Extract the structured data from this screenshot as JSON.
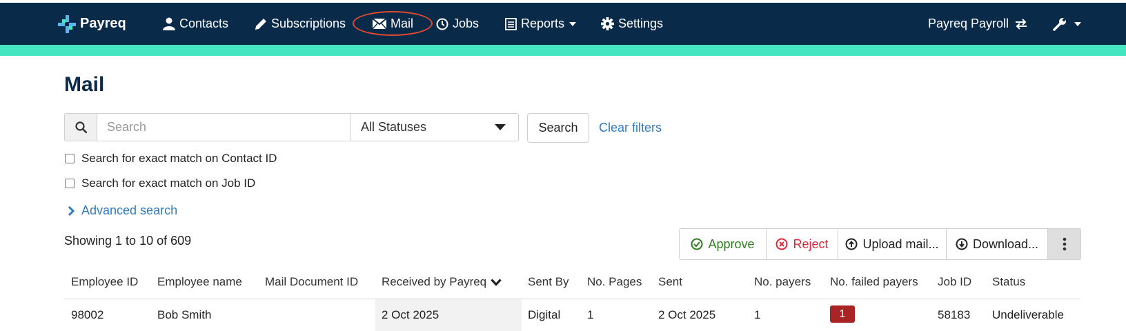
{
  "nav": {
    "brand": "Payreq",
    "items": [
      {
        "label": "Contacts",
        "icon": "user-icon"
      },
      {
        "label": "Subscriptions",
        "icon": "pencil-icon"
      },
      {
        "label": "Mail",
        "icon": "envelope-icon"
      },
      {
        "label": "Jobs",
        "icon": "clock-icon"
      },
      {
        "label": "Reports",
        "icon": "list-icon"
      },
      {
        "label": "Settings",
        "icon": "gear-icon"
      }
    ],
    "account": "Payreq Payroll",
    "colors": {
      "bar": "#0a2a4a",
      "accent": "#43e6c1",
      "highlight": "#e64a2e"
    }
  },
  "page": {
    "title": "Mail"
  },
  "filters": {
    "search_placeholder": "Search",
    "search_value": "",
    "status_selected": "All Statuses",
    "search_button": "Search",
    "clear_filters": "Clear filters",
    "exact_contact": "Search for exact match on Contact ID",
    "exact_job": "Search for exact match on Job ID",
    "advanced": "Advanced search"
  },
  "results": {
    "showing": "Showing 1 to 10 of 609"
  },
  "actions": {
    "approve": "Approve",
    "reject": "Reject",
    "upload": "Upload mail...",
    "download": "Download..."
  },
  "table": {
    "columns": [
      "Employee ID",
      "Employee name",
      "Mail Document ID",
      "Received by Payreq",
      "Sent By",
      "No. Pages",
      "Sent",
      "No. payers",
      "No. failed payers",
      "Job ID",
      "Status"
    ],
    "sorted_column": "Received by Payreq",
    "rows": [
      {
        "employee_id": "98002",
        "employee_name": "Bob Smith",
        "mail_document_id": "",
        "received": "2 Oct 2025",
        "sent_by": "Digital",
        "pages": "1",
        "sent": "2 Oct 2025",
        "payers": "1",
        "failed_payers": "1",
        "job_id": "58183",
        "status": "Undeliverable"
      }
    ]
  }
}
